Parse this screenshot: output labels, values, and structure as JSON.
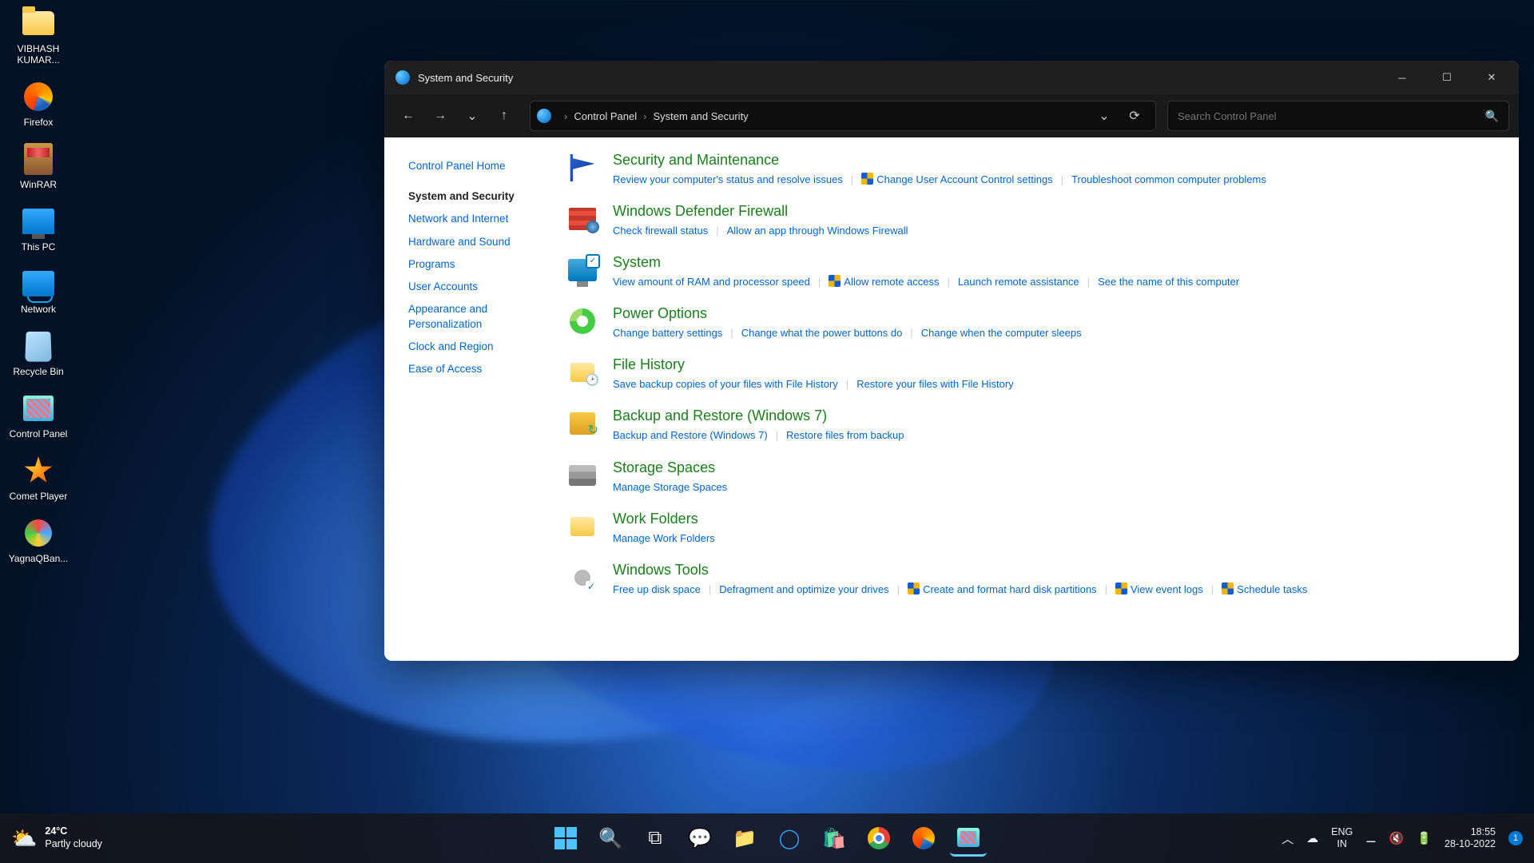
{
  "desktop": {
    "icons": [
      {
        "label": "VIBHASH KUMAR...",
        "kind": "folder"
      },
      {
        "label": "Firefox",
        "kind": "firefox"
      },
      {
        "label": "WinRAR",
        "kind": "winrar"
      },
      {
        "label": "This PC",
        "kind": "thispc"
      },
      {
        "label": "Network",
        "kind": "network"
      },
      {
        "label": "Recycle Bin",
        "kind": "recycle"
      },
      {
        "label": "Control Panel",
        "kind": "cp"
      },
      {
        "label": "Comet Player",
        "kind": "comet"
      },
      {
        "label": "YagnaQBan...",
        "kind": "yagna"
      }
    ]
  },
  "window": {
    "title": "System and Security",
    "breadcrumb": {
      "root": "Control Panel",
      "current": "System and Security",
      "sep": "›"
    },
    "search_placeholder": "Search Control Panel",
    "sidebar": [
      {
        "label": "Control Panel Home",
        "active": false,
        "home": true
      },
      {
        "label": "System and Security",
        "active": true
      },
      {
        "label": "Network and Internet",
        "active": false
      },
      {
        "label": "Hardware and Sound",
        "active": false
      },
      {
        "label": "Programs",
        "active": false
      },
      {
        "label": "User Accounts",
        "active": false
      },
      {
        "label": "Appearance and Personalization",
        "active": false
      },
      {
        "label": "Clock and Region",
        "active": false
      },
      {
        "label": "Ease of Access",
        "active": false
      }
    ],
    "groups": [
      {
        "icon": "flag",
        "title": "Security and Maintenance",
        "links": [
          {
            "t": "Review your computer's status and resolve issues"
          },
          {
            "t": "Change User Account Control settings",
            "shield": true
          },
          {
            "t": "Troubleshoot common computer problems"
          }
        ]
      },
      {
        "icon": "firewall",
        "title": "Windows Defender Firewall",
        "links": [
          {
            "t": "Check firewall status"
          },
          {
            "t": "Allow an app through Windows Firewall"
          }
        ]
      },
      {
        "icon": "system",
        "title": "System",
        "links": [
          {
            "t": "View amount of RAM and processor speed"
          },
          {
            "t": "Allow remote access",
            "shield": true
          },
          {
            "t": "Launch remote assistance"
          },
          {
            "t": "See the name of this computer"
          }
        ]
      },
      {
        "icon": "power",
        "title": "Power Options",
        "links": [
          {
            "t": "Change battery settings"
          },
          {
            "t": "Change what the power buttons do"
          },
          {
            "t": "Change when the computer sleeps"
          }
        ]
      },
      {
        "icon": "fh",
        "title": "File History",
        "links": [
          {
            "t": "Save backup copies of your files with File History"
          },
          {
            "t": "Restore your files with File History"
          }
        ]
      },
      {
        "icon": "backup",
        "title": "Backup and Restore (Windows 7)",
        "links": [
          {
            "t": "Backup and Restore (Windows 7)"
          },
          {
            "t": "Restore files from backup"
          }
        ]
      },
      {
        "icon": "storage",
        "title": "Storage Spaces",
        "links": [
          {
            "t": "Manage Storage Spaces"
          }
        ]
      },
      {
        "icon": "workf",
        "title": "Work Folders",
        "links": [
          {
            "t": "Manage Work Folders"
          }
        ]
      },
      {
        "icon": "tools",
        "title": "Windows Tools",
        "links": [
          {
            "t": "Free up disk space"
          },
          {
            "t": "Defragment and optimize your drives"
          },
          {
            "t": "Create and format hard disk partitions",
            "shield": true
          },
          {
            "t": "View event logs",
            "shield": true
          },
          {
            "t": "Schedule tasks",
            "shield": true
          }
        ]
      }
    ]
  },
  "taskbar": {
    "weather": {
      "temp": "24°C",
      "desc": "Partly cloudy"
    },
    "lang": {
      "top": "ENG",
      "bot": "IN"
    },
    "clock": {
      "time": "18:55",
      "date": "28-10-2022"
    },
    "notif_count": "1"
  }
}
